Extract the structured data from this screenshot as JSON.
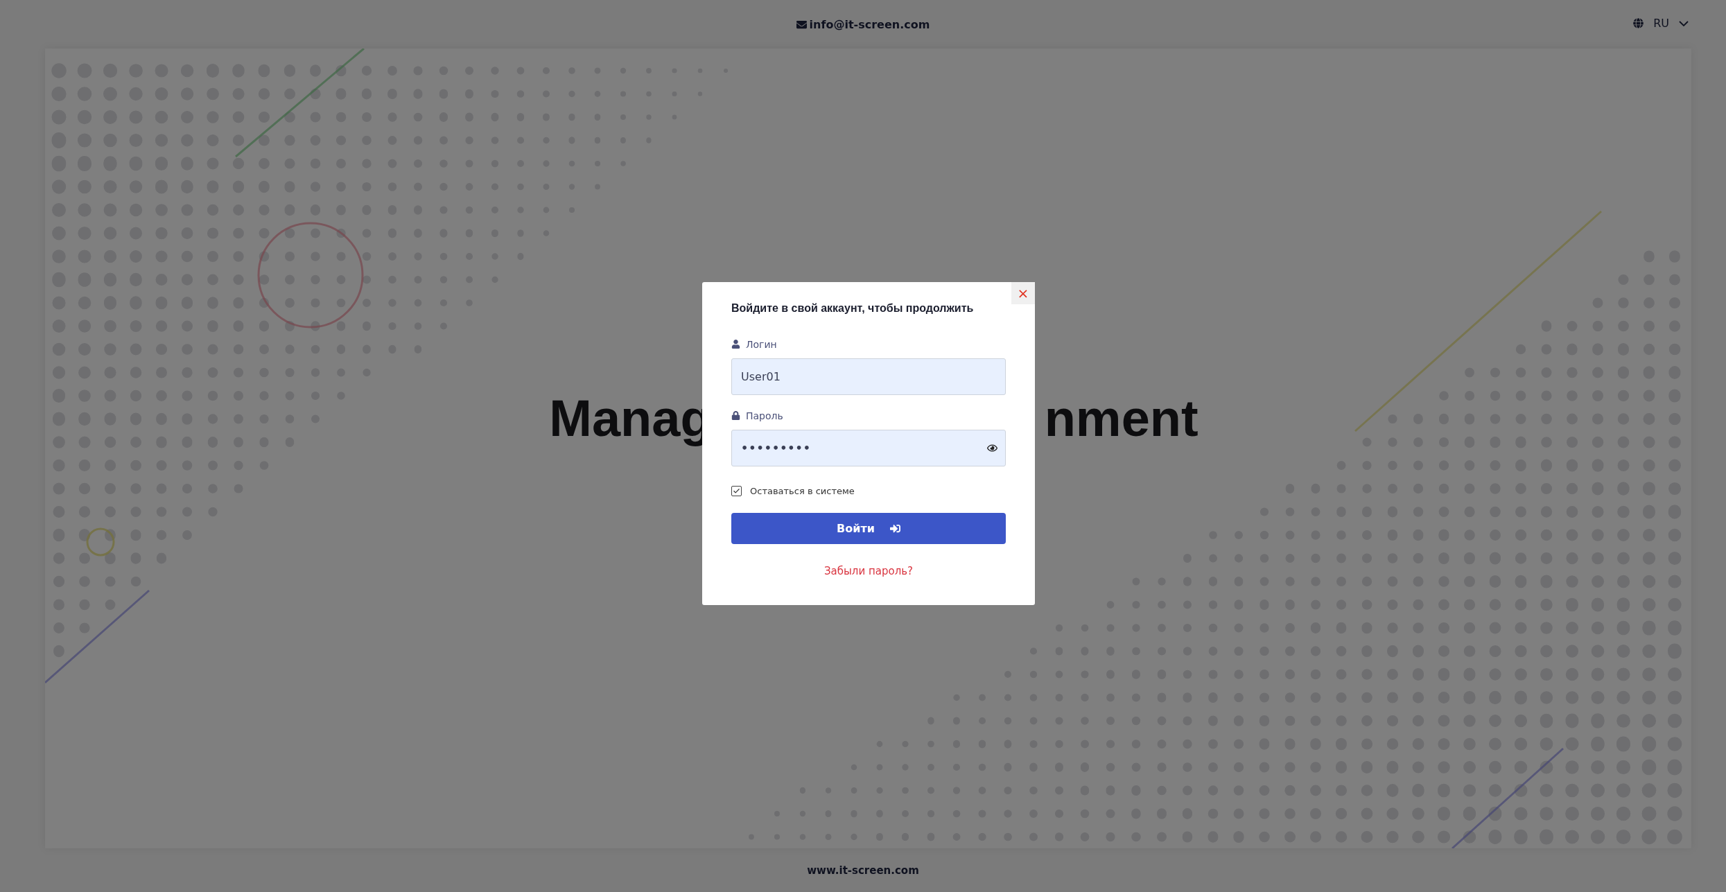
{
  "header": {
    "email": "info@it-screen.com",
    "language": "RU"
  },
  "hero": {
    "heading_parts": [
      "Manag",
      "nment"
    ]
  },
  "login_dialog": {
    "close": "×",
    "title": "Войдите в свой аккаунт, чтобы продолжить",
    "fields": [
      {
        "kind": "text",
        "label": "Логин",
        "value": "User01"
      },
      {
        "kind": "password",
        "label": "Пароль",
        "value": "•••••••••"
      }
    ],
    "remember": {
      "label": "Оставаться в системе",
      "checked": true
    },
    "submit": "Войти",
    "forgot": "Забыли пароль?"
  },
  "footer": {
    "website": "www.it-screen.com"
  }
}
